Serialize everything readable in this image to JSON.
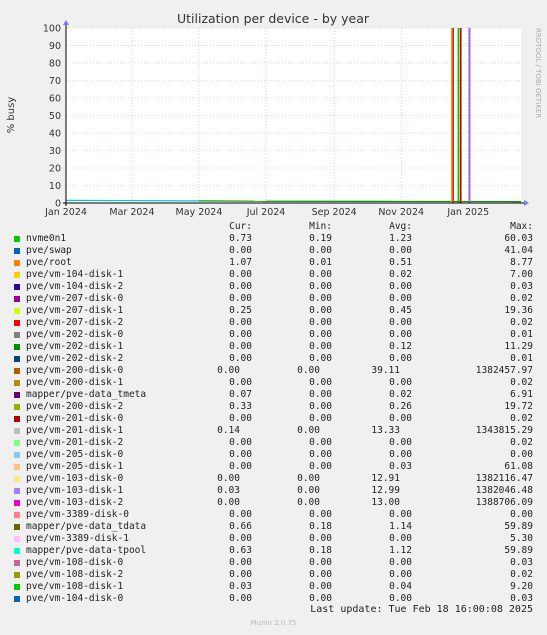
{
  "chart_data": {
    "type": "line",
    "title": "Utilization per device - by year",
    "ylabel": "% busy",
    "side_label": "RRDTOOL / TOBI OETIKER",
    "ylim": [
      0,
      100
    ],
    "yticks": [
      0,
      10,
      20,
      30,
      40,
      50,
      60,
      70,
      80,
      90,
      100
    ],
    "xlim": [
      "2024-01-01",
      "2025-02-18"
    ],
    "xticks": [
      {
        "date": "2024-01-01",
        "label": "Jan 2024"
      },
      {
        "date": "2024-03-01",
        "label": "Mar 2024"
      },
      {
        "date": "2024-05-01",
        "label": "May 2024"
      },
      {
        "date": "2024-07-01",
        "label": "Jul 2024"
      },
      {
        "date": "2024-09-01",
        "label": "Sep 2024"
      },
      {
        "date": "2024-11-01",
        "label": "Nov 2024"
      },
      {
        "date": "2025-01-01",
        "label": "Jan 2025"
      }
    ],
    "grid": true,
    "spikes": [
      {
        "date": "2024-12-17",
        "value": 100,
        "color": "#E6A24A"
      },
      {
        "date": "2024-12-17",
        "value": 100,
        "color": "#CC3300"
      },
      {
        "date": "2024-12-23",
        "value": 100,
        "color": "#00CC00"
      },
      {
        "date": "2024-12-24",
        "value": 100,
        "color": "#B4A220"
      },
      {
        "date": "2024-12-25",
        "value": 100,
        "color": "#CC0000"
      },
      {
        "date": "2025-01-01",
        "value": 100,
        "color": "#BB88EE"
      },
      {
        "date": "2025-01-02",
        "value": 100,
        "color": "#9966CC"
      }
    ],
    "baseline": [
      {
        "date": "2024-01-01",
        "value": 1.5,
        "color": "#00CCCC"
      },
      {
        "date": "2024-05-01",
        "value": 1.2,
        "color": "#00CCCC"
      },
      {
        "date": "2024-07-01",
        "value": 1.0,
        "color": "#009900"
      },
      {
        "date": "2024-11-01",
        "value": 0.9,
        "color": "#009900"
      },
      {
        "date": "2025-02-18",
        "value": 0.8,
        "color": "#009900"
      }
    ]
  },
  "legend": {
    "headers": {
      "cur": "Cur:",
      "min": "Min:",
      "avg": "Avg:",
      "max": "Max:"
    },
    "rows": [
      {
        "name": "nvme0n1",
        "cur": "0.73",
        "min": "0.19",
        "avg": "1.23",
        "max": "60.03",
        "color": "#00CC00"
      },
      {
        "name": "pve/swap",
        "cur": "0.00",
        "min": "0.00",
        "avg": "0.00",
        "max": "41.04",
        "color": "#0066B3"
      },
      {
        "name": "pve/root",
        "cur": "1.07",
        "min": "0.01",
        "avg": "0.51",
        "max": "8.77",
        "color": "#FF8000"
      },
      {
        "name": "pve/vm-104-disk-1",
        "cur": "0.00",
        "min": "0.00",
        "avg": "0.02",
        "max": "7.00",
        "color": "#FFCC00"
      },
      {
        "name": "pve/vm-104-disk-2",
        "cur": "0.00",
        "min": "0.00",
        "avg": "0.00",
        "max": "0.03",
        "color": "#330099"
      },
      {
        "name": "pve/vm-207-disk-0",
        "cur": "0.00",
        "min": "0.00",
        "avg": "0.00",
        "max": "0.02",
        "color": "#990099"
      },
      {
        "name": "pve/vm-207-disk-1",
        "cur": "0.25",
        "min": "0.00",
        "avg": "0.45",
        "max": "19.36",
        "color": "#CCFF00"
      },
      {
        "name": "pve/vm-207-disk-2",
        "cur": "0.00",
        "min": "0.00",
        "avg": "0.00",
        "max": "0.02",
        "color": "#FF0000"
      },
      {
        "name": "pve/vm-202-disk-0",
        "cur": "0.00",
        "min": "0.00",
        "avg": "0.00",
        "max": "0.01",
        "color": "#808080"
      },
      {
        "name": "pve/vm-202-disk-1",
        "cur": "0.00",
        "min": "0.00",
        "avg": "0.12",
        "max": "11.29",
        "color": "#008F00"
      },
      {
        "name": "pve/vm-202-disk-2",
        "cur": "0.00",
        "min": "0.00",
        "avg": "0.00",
        "max": "0.01",
        "color": "#00487D"
      },
      {
        "name": "pve/vm-200-disk-0",
        "cur": "0.00",
        "min": "0.00",
        "avg": "39.11",
        "max": "1382457.97",
        "color": "#B35A00",
        "wide": true
      },
      {
        "name": "pve/vm-200-disk-1",
        "cur": "0.00",
        "min": "0.00",
        "avg": "0.00",
        "max": "0.02",
        "color": "#B38F00"
      },
      {
        "name": "mapper/pve-data_tmeta",
        "cur": "0.07",
        "min": "0.00",
        "avg": "0.02",
        "max": "6.91",
        "color": "#6B006B"
      },
      {
        "name": "pve/vm-200-disk-2",
        "cur": "0.33",
        "min": "0.00",
        "avg": "0.26",
        "max": "19.72",
        "color": "#8FB300"
      },
      {
        "name": "pve/vm-201-disk-0",
        "cur": "0.00",
        "min": "0.00",
        "avg": "0.00",
        "max": "0.02",
        "color": "#B30000"
      },
      {
        "name": "pve/vm-201-disk-1",
        "cur": "0.14",
        "min": "0.00",
        "avg": "13.33",
        "max": "1343815.29",
        "color": "#BEBEBE",
        "wide": true
      },
      {
        "name": "pve/vm-201-disk-2",
        "cur": "0.00",
        "min": "0.00",
        "avg": "0.00",
        "max": "0.02",
        "color": "#80FF80"
      },
      {
        "name": "pve/vm-205-disk-0",
        "cur": "0.00",
        "min": "0.00",
        "avg": "0.00",
        "max": "0.00",
        "color": "#80C9FF"
      },
      {
        "name": "pve/vm-205-disk-1",
        "cur": "0.00",
        "min": "0.00",
        "avg": "0.03",
        "max": "61.08",
        "color": "#FFC080"
      },
      {
        "name": "pve/vm-103-disk-0",
        "cur": "0.00",
        "min": "0.00",
        "avg": "12.91",
        "max": "1382116.47",
        "color": "#FFE680",
        "wide": true
      },
      {
        "name": "pve/vm-103-disk-1",
        "cur": "0.03",
        "min": "0.00",
        "avg": "12.99",
        "max": "1382046.48",
        "color": "#AA80FF",
        "wide": true
      },
      {
        "name": "pve/vm-103-disk-2",
        "cur": "0.00",
        "min": "0.00",
        "avg": "13.00",
        "max": "1388706.09",
        "color": "#EE00CC",
        "wide": true
      },
      {
        "name": "pve/vm-3389-disk-0",
        "cur": "0.00",
        "min": "0.00",
        "avg": "0.00",
        "max": "0.00",
        "color": "#FF8080"
      },
      {
        "name": "mapper/pve-data_tdata",
        "cur": "0.66",
        "min": "0.18",
        "avg": "1.14",
        "max": "59.89",
        "color": "#666600"
      },
      {
        "name": "pve/vm-3389-disk-1",
        "cur": "0.00",
        "min": "0.00",
        "avg": "0.00",
        "max": "5.30",
        "color": "#FFBFFF"
      },
      {
        "name": "mapper/pve-data-tpool",
        "cur": "0.63",
        "min": "0.18",
        "avg": "1.12",
        "max": "59.89",
        "color": "#00FFCC"
      },
      {
        "name": "pve/vm-108-disk-0",
        "cur": "0.00",
        "min": "0.00",
        "avg": "0.00",
        "max": "0.03",
        "color": "#CC6699"
      },
      {
        "name": "pve/vm-108-disk-2",
        "cur": "0.00",
        "min": "0.00",
        "avg": "0.00",
        "max": "0.02",
        "color": "#999900"
      },
      {
        "name": "pve/vm-108-disk-1",
        "cur": "0.03",
        "min": "0.00",
        "avg": "0.04",
        "max": "9.20",
        "color": "#00CC00"
      },
      {
        "name": "pve/vm-104-disk-0",
        "cur": "0.00",
        "min": "0.00",
        "avg": "0.00",
        "max": "0.03",
        "color": "#0066B3"
      }
    ]
  },
  "footer": {
    "last_update": "Last update: Tue Feb 18 16:00:08 2025",
    "munin": "Munin 2.0.75"
  }
}
